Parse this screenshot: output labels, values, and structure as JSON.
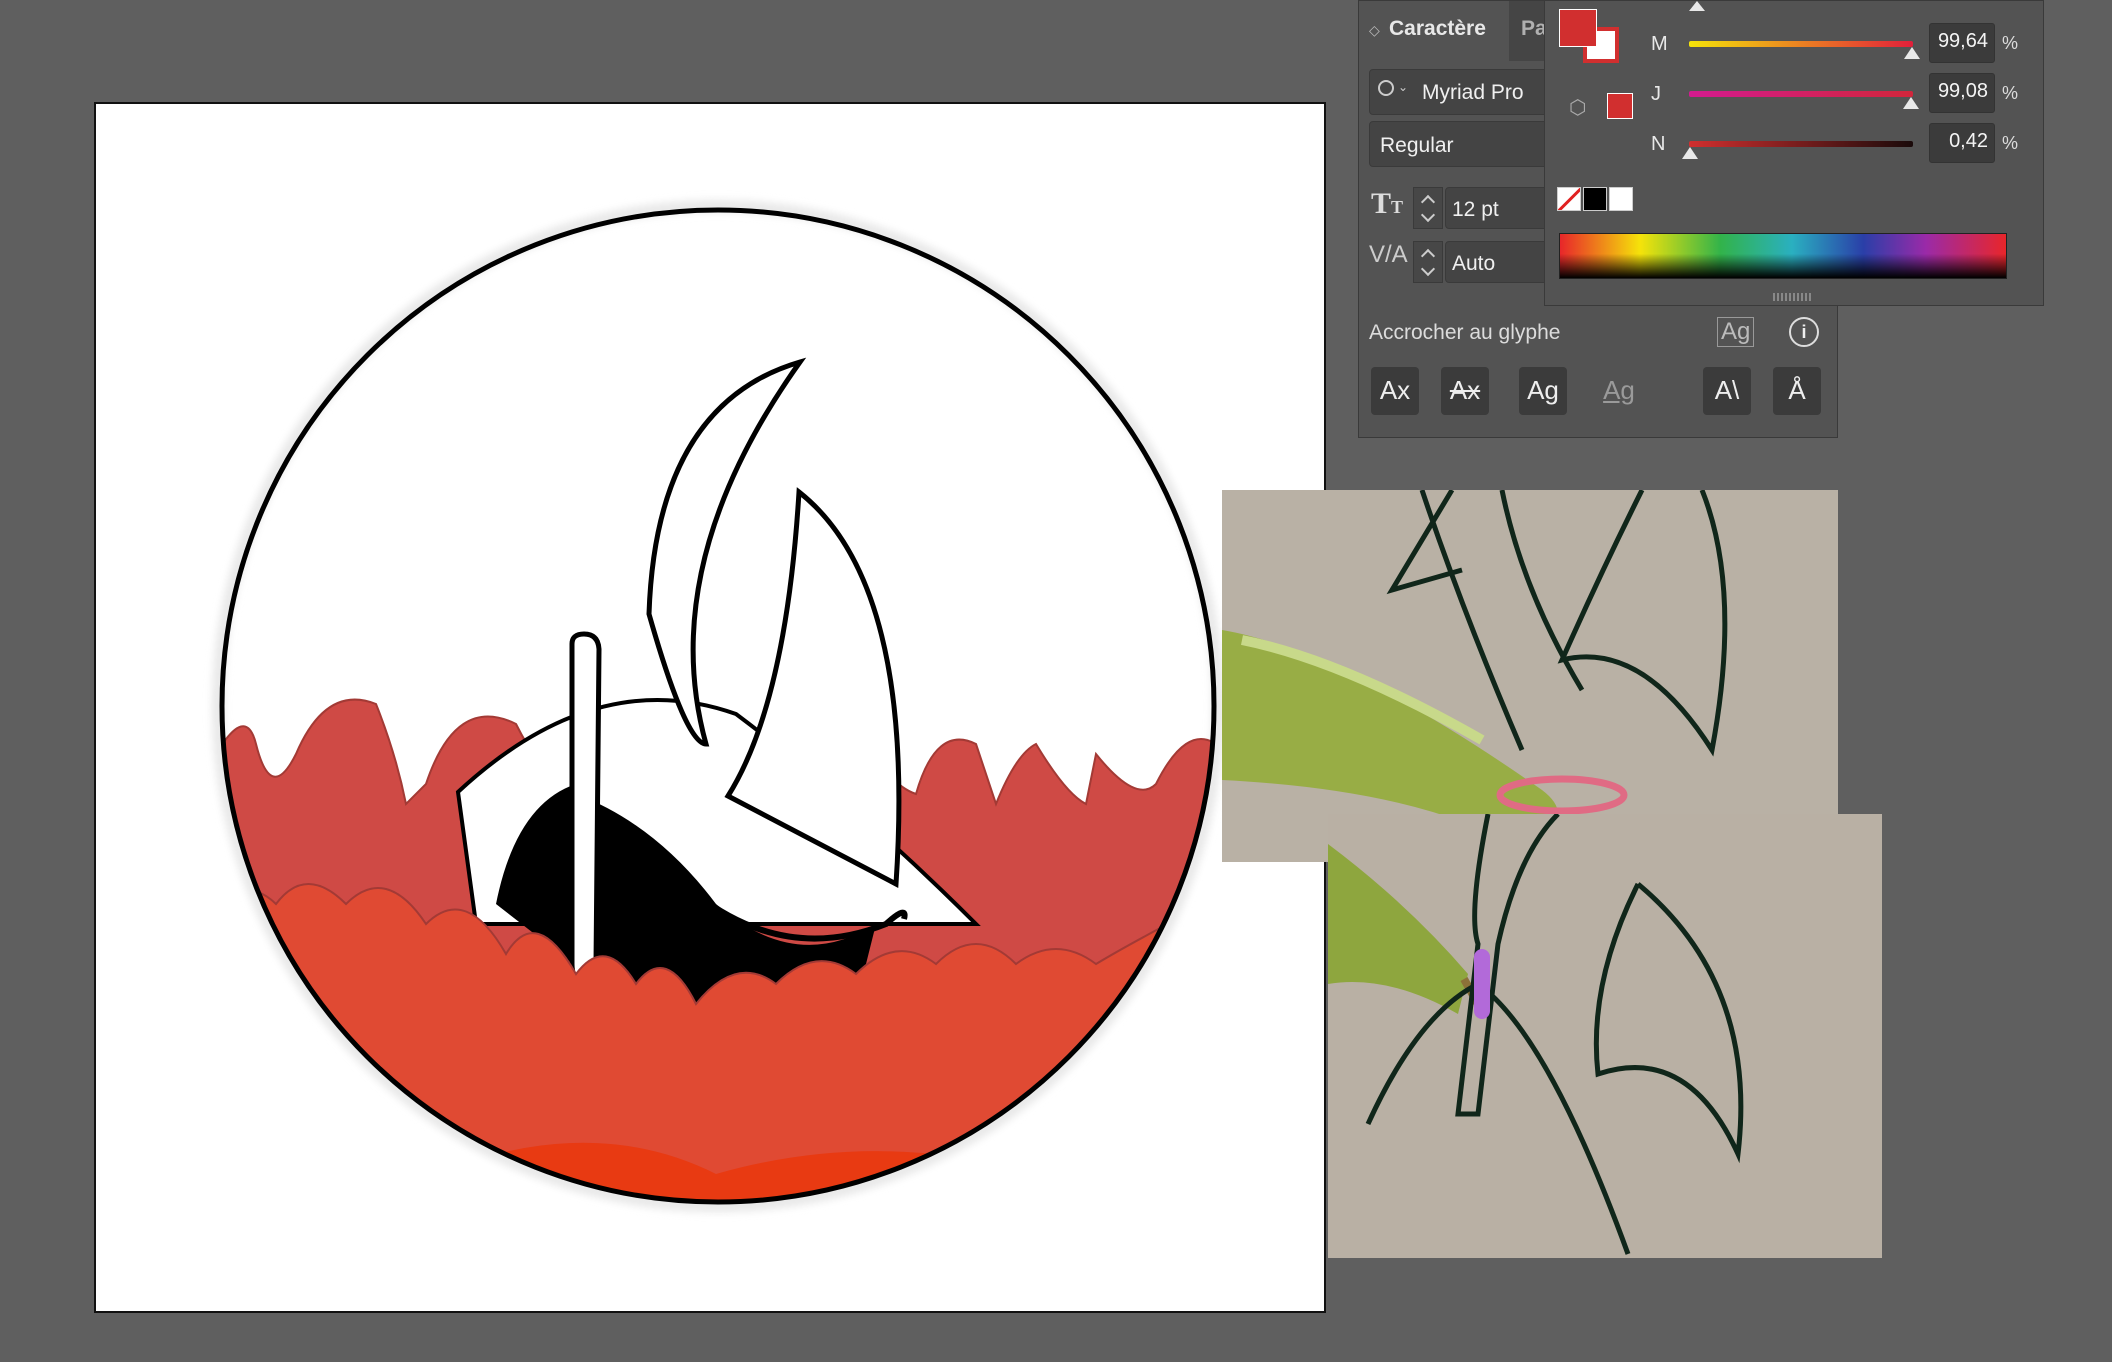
{
  "character_panel": {
    "tab_active": "Caractère",
    "tab_next": "Pa",
    "font_family": "Myriad Pro",
    "font_style": "Regular",
    "font_size": "12 pt",
    "kerning": "Auto",
    "snap_label": "Accrocher au glyphe",
    "glyph_buttons": [
      "Ax",
      "Ax",
      "Ag",
      "Ag",
      "A\\",
      "Å"
    ]
  },
  "color_panel": {
    "fill_color": "#d12f2f",
    "sliders": [
      {
        "label": "M",
        "value": "99,64",
        "unit": "%",
        "level": 0.9964
      },
      {
        "label": "J",
        "value": "99,08",
        "unit": "%",
        "level": 0.9908
      },
      {
        "label": "N",
        "value": "0,42",
        "unit": "%",
        "level": 0.0042
      }
    ]
  },
  "colors": {
    "canvas_bg": "#5f5f5f",
    "panel_bg": "#535353",
    "flame_dark": "#cf4a45",
    "flame_mid": "#e04a33",
    "flame_bright": "#e83a12"
  }
}
